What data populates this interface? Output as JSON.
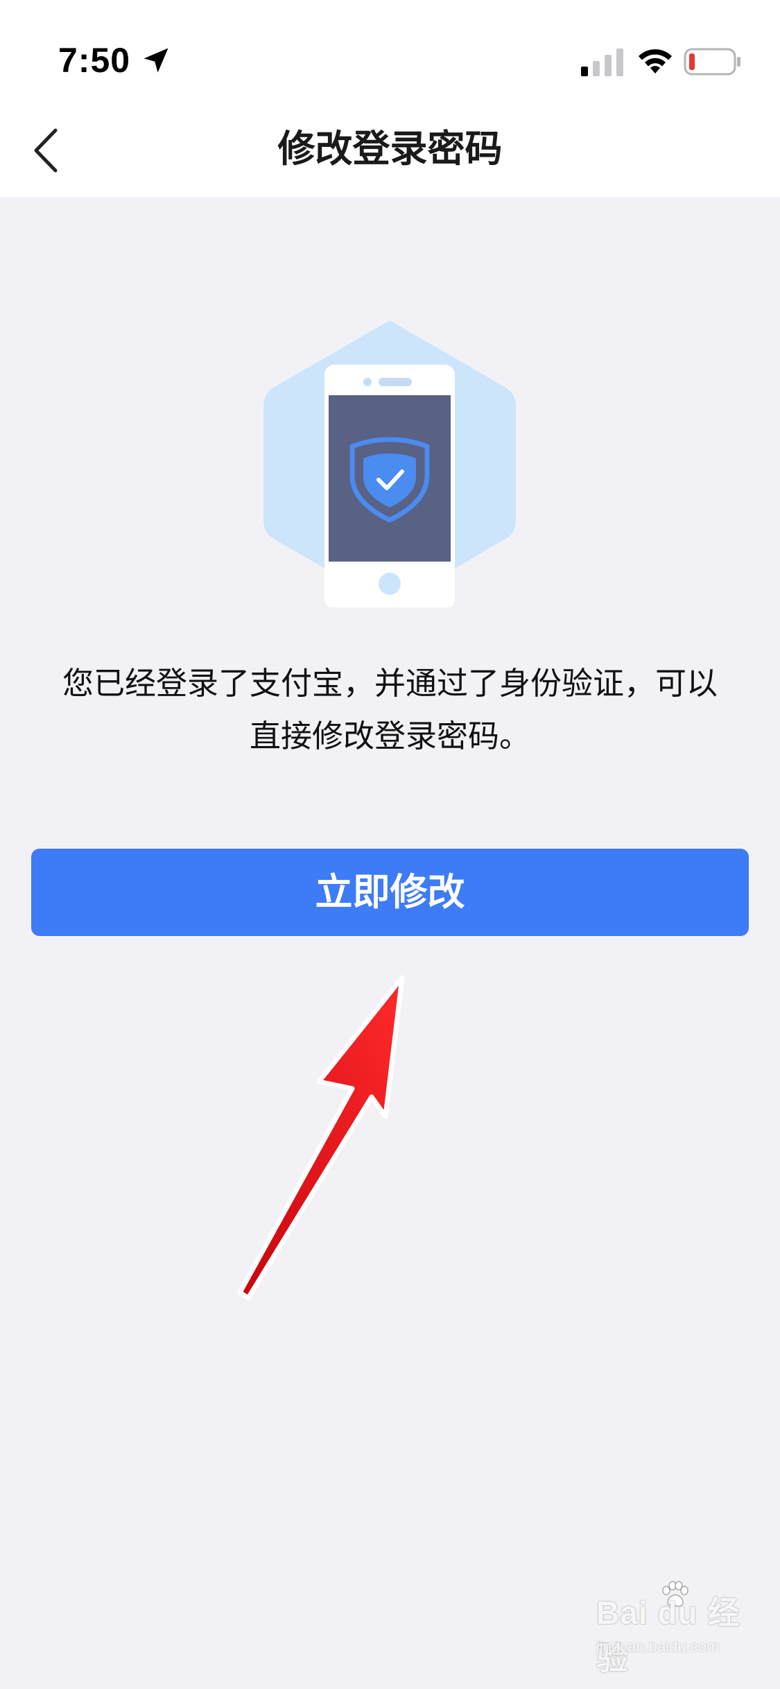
{
  "status_bar": {
    "time": "7:50",
    "icons": [
      "location-arrow-icon",
      "cellular-signal-icon",
      "wifi-icon",
      "battery-low-icon"
    ]
  },
  "nav": {
    "title": "修改登录密码",
    "back_icon": "chevron-left-icon"
  },
  "illustration": {
    "icon": "phone-shield-icon",
    "colors": {
      "hexagon": "#cde5fb",
      "phone_body": "#ffffff",
      "screen": "#596185",
      "shield": "#4a8cf0"
    }
  },
  "main": {
    "description_line1": "您已经登录了支付宝，并通过了身份验证，可以",
    "description_line2": "直接修改登录密码。",
    "button_label": "立即修改"
  },
  "annotation": {
    "icon": "red-arrow-icon",
    "color": "#e8141b"
  },
  "watermark": {
    "brand": "Bai du 经验",
    "site": "jingyan.baidu.com",
    "icon": "baidu-paw-icon"
  },
  "colors": {
    "accent": "#3d7bf7",
    "background": "#f2f2f6"
  }
}
